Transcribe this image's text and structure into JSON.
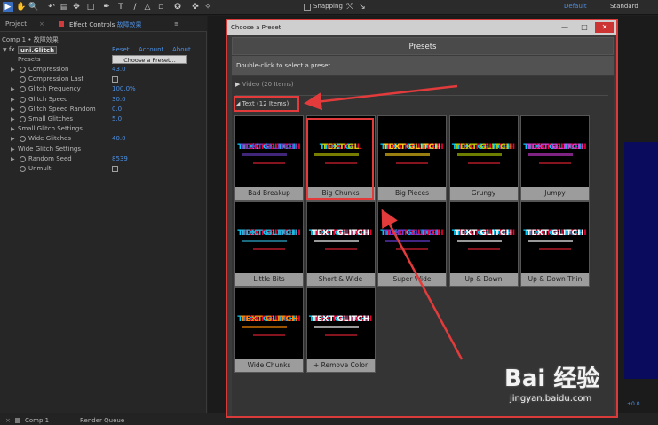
{
  "toolbar": {
    "snapping_label": "Snapping",
    "workspace_default": "Default",
    "workspace_standard": "Standard"
  },
  "left_panel": {
    "tab_project": "Project",
    "tab_effect_controls": "Effect Controls",
    "tab_effect_target": "故障效果",
    "comp_path": "Comp 1 • 故障效果",
    "effect_name": "uni.Glitch",
    "reset": "Reset",
    "account": "Account",
    "about": "About...",
    "presets_label": "Presets",
    "choose_preset_button": "Choose a Preset...",
    "params": [
      {
        "label": "Compression",
        "value": "43.0",
        "has_stopwatch": true,
        "has_triangle": true
      },
      {
        "label": "Compression Last",
        "value": "",
        "checkbox": true,
        "has_stopwatch": true,
        "has_triangle": false
      },
      {
        "label": "Glitch Frequency",
        "value": "100.0%",
        "has_stopwatch": true,
        "has_triangle": true
      },
      {
        "label": "Glitch Speed",
        "value": "30.0",
        "has_stopwatch": true,
        "has_triangle": true
      },
      {
        "label": "Glitch Speed Random",
        "value": "0.0",
        "has_stopwatch": true,
        "has_triangle": true
      },
      {
        "label": "Small Glitches",
        "value": "5.0",
        "has_stopwatch": true,
        "has_triangle": true
      },
      {
        "label": "Small Glitch Settings",
        "value": "",
        "has_stopwatch": false,
        "has_triangle": true,
        "section": true
      },
      {
        "label": "Wide Glitches",
        "value": "40.0",
        "has_stopwatch": true,
        "has_triangle": true
      },
      {
        "label": "Wide Glitch Settings",
        "value": "",
        "has_stopwatch": false,
        "has_triangle": true,
        "section": true
      },
      {
        "label": "Random Seed",
        "value": "8539",
        "has_stopwatch": true,
        "has_triangle": true
      },
      {
        "label": "Unmult",
        "value": "",
        "checkbox": true,
        "has_stopwatch": true,
        "has_triangle": false
      }
    ]
  },
  "bottom_bar": {
    "comp_tab": "Comp 1",
    "render_queue": "Render Queue",
    "right_value": "+0.0"
  },
  "dialog": {
    "title": "Choose a Preset",
    "header": "Presets",
    "instruction": "Double-click to select a preset.",
    "video_category": "Video (20 Items)",
    "text_category": "Text (12 Items)",
    "presets": [
      {
        "name": "Bad Breakup",
        "preview_text": "TEXT GLITCH",
        "color": "#6b3fc9"
      },
      {
        "name": "Big Chunks",
        "preview_text": "TEXT GL",
        "color": "#c8d000"
      },
      {
        "name": "Big Pieces",
        "preview_text": "TEXT GLITCH",
        "color": "#ffd21a"
      },
      {
        "name": "Grungy",
        "preview_text": "TEXT GLITCH",
        "color": "#b6d000"
      },
      {
        "name": "Jumpy",
        "preview_text": "TEXT GLITCH",
        "color": "#d23bd9"
      },
      {
        "name": "Little Bits",
        "preview_text": "TEXT GLITCH",
        "color": "#2fb0d6"
      },
      {
        "name": "Short & Wide",
        "preview_text": "TEXT GLITCH",
        "color": "#ffffff"
      },
      {
        "name": "Super Wide",
        "preview_text": "TEXT GLITCH",
        "color": "#6a3fd9"
      },
      {
        "name": "Up & Down",
        "preview_text": "TEXT GLITCH",
        "color": "#ffffff"
      },
      {
        "name": "Up & Down Thin",
        "preview_text": "TEXT GLITCH",
        "color": "#ffffff"
      },
      {
        "name": "Wide Chunks",
        "preview_text": "TEXT GLITCH",
        "color": "#ff8a00"
      },
      {
        "name": "+ Remove Color",
        "preview_text": "TEXT GLITCH",
        "color": "#ffffff"
      }
    ]
  },
  "watermark": {
    "main": "Bai 经验",
    "sub": "jingyan.baidu.com"
  }
}
